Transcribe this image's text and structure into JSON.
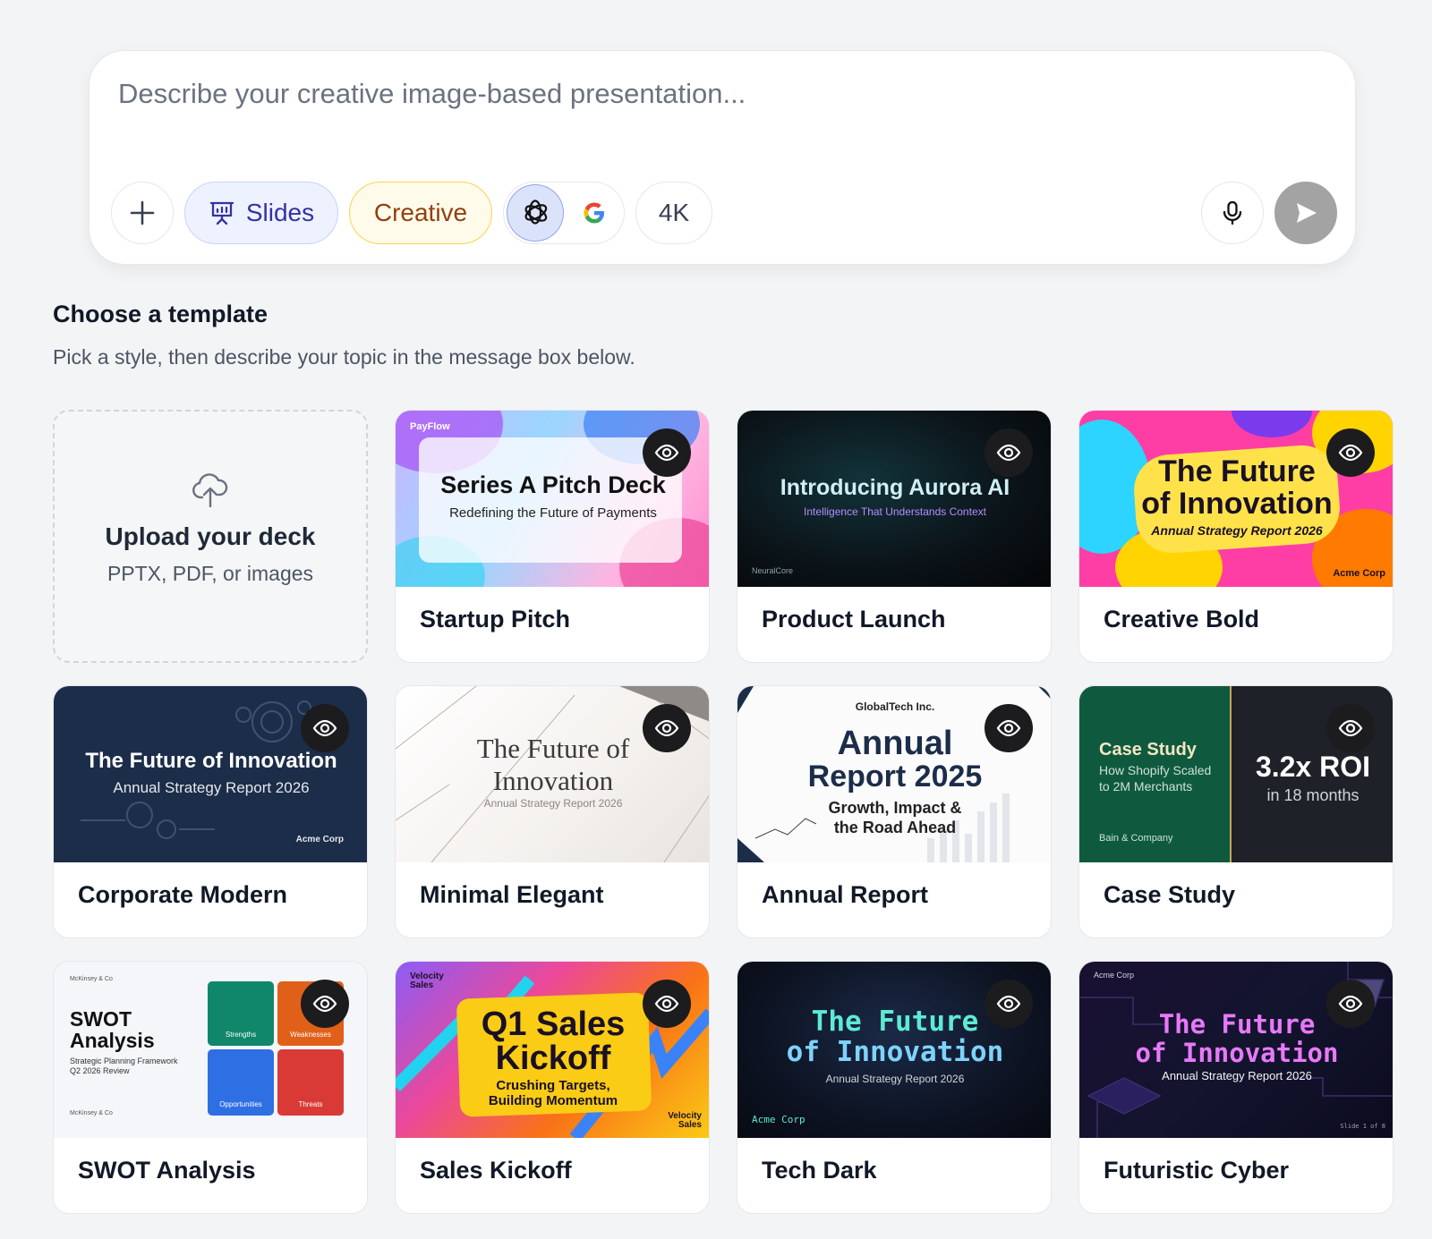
{
  "composer": {
    "placeholder": "Describe your creative image-based presentation...",
    "slides_label": "Slides",
    "creative_label": "Creative",
    "resolution_label": "4K"
  },
  "header": {
    "title": "Choose a template",
    "subtitle": "Pick a style, then describe your topic in the message box below."
  },
  "upload": {
    "title": "Upload your deck",
    "subtitle": "PPTX, PDF, or images"
  },
  "templates": [
    {
      "name": "Startup Pitch",
      "preview": {
        "brand": "PayFlow",
        "title": "Series A Pitch Deck",
        "subtitle": "Redefining the Future of Payments"
      }
    },
    {
      "name": "Product Launch",
      "preview": {
        "title": "Introducing Aurora AI",
        "subtitle": "Intelligence That Understands Context",
        "footer": "NeuralCore"
      }
    },
    {
      "name": "Creative Bold",
      "preview": {
        "title_1": "The Future",
        "title_2": "of Innovation",
        "subtitle": "Annual Strategy Report 2026",
        "footer": "Acme Corp"
      }
    },
    {
      "name": "Corporate Modern",
      "preview": {
        "title": "The Future of Innovation",
        "subtitle": "Annual Strategy Report 2026",
        "footer": "Acme Corp"
      }
    },
    {
      "name": "Minimal Elegant",
      "preview": {
        "title_1": "The Future of",
        "title_2": "Innovation",
        "subtitle": "Annual Strategy Report 2026"
      }
    },
    {
      "name": "Annual Report",
      "preview": {
        "company": "GlobalTech Inc.",
        "title_1": "Annual",
        "title_2": "Report 2025",
        "subtitle_1": "Growth, Impact &",
        "subtitle_2": "the Road Ahead"
      }
    },
    {
      "name": "Case Study",
      "preview": {
        "label": "Case Study",
        "desc_1": "How Shopify Scaled",
        "desc_2": "to 2M Merchants",
        "footer": "Bain & Company",
        "metric": "3.2x ROI",
        "metric_sub": "in 18 months"
      }
    },
    {
      "name": "SWOT Analysis",
      "preview": {
        "brand": "McKinsey & Co",
        "title_1": "SWOT",
        "title_2": "Analysis",
        "sub_1": "Strategic Planning Framework",
        "sub_2": "Q2 2026 Review",
        "quadrants": [
          "Strengths",
          "Weaknesses",
          "Opportunities",
          "Threats"
        ]
      }
    },
    {
      "name": "Sales Kickoff",
      "preview": {
        "brand_1": "Velocity",
        "brand_2": "Sales",
        "title_1": "Q1 Sales",
        "title_2": "Kickoff",
        "sub_1": "Crushing Targets,",
        "sub_2": "Building Momentum"
      }
    },
    {
      "name": "Tech Dark",
      "preview": {
        "title_1": "The Future",
        "title_2": "of Innovation",
        "subtitle": "Annual Strategy Report 2026",
        "footer": "Acme Corp"
      }
    },
    {
      "name": "Futuristic Cyber",
      "preview": {
        "brand": "Acme Corp",
        "title_1": "The Future",
        "title_2": "of Innovation",
        "subtitle": "Annual Strategy Report 2026",
        "footer": "Slide 1 of 8"
      }
    }
  ],
  "colors": {
    "accent": "#3730a3",
    "creative": "#92400e",
    "send_disabled": "#a3a3a3"
  },
  "icons": [
    "plus-icon",
    "presentation-icon",
    "openai-icon",
    "google-icon",
    "microphone-icon",
    "send-icon",
    "eye-icon",
    "cloud-upload-icon"
  ]
}
